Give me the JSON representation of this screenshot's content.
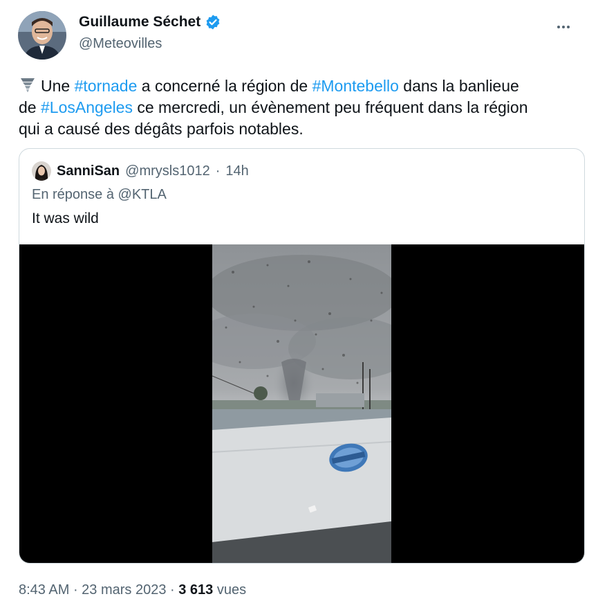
{
  "author": {
    "display_name": "Guillaume Séchet",
    "handle": "@Meteovilles",
    "avatar_icon": "profile-photo",
    "verified_icon": "verified-badge-icon",
    "more_icon": "more-options-icon"
  },
  "tweet": {
    "emoji_icon": "tornado-emoji-icon",
    "line1": {
      "t1": "Une ",
      "h1": "#tornade",
      "t2": " a concerné la région de ",
      "h2": "#Montebello",
      "t3": " dans la banlieue"
    },
    "line2": {
      "t1": "de ",
      "h1": "#LosAngeles",
      "t2": " ce mercredi, un évènement peu fréquent dans la région"
    },
    "line3": "qui a causé des dégâts parfois notables."
  },
  "quoted": {
    "display_name": "SanniSan",
    "handle": "@mrysls1012",
    "separator": "·",
    "time": "14h",
    "reply_to": "En réponse à @KTLA",
    "text": "It was wild"
  },
  "meta": {
    "time": "8:43 AM",
    "sep1": " · ",
    "date": "23 mars 2023",
    "sep2": " · ",
    "views_count": "3 613",
    "views_label": " vues"
  },
  "colors": {
    "link": "#1d9bf0",
    "secondary_text": "#536471",
    "primary_text": "#0f1419",
    "border": "#cfd9de"
  }
}
